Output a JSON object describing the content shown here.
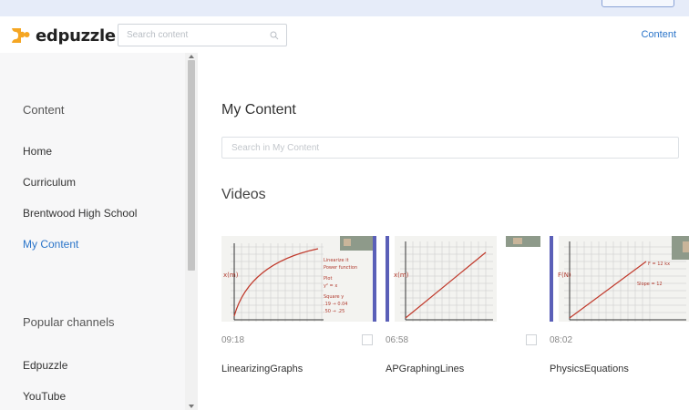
{
  "app": {
    "logo_text": "edpuzzle",
    "brand_color": "#f5a623"
  },
  "topbar": {
    "search_placeholder": "Search content",
    "right_link": "Content",
    "link_color": "#2a74c9"
  },
  "sidebar": {
    "heading_content": "Content",
    "items": [
      {
        "label": "Home"
      },
      {
        "label": "Curriculum"
      },
      {
        "label": "Brentwood High School"
      },
      {
        "label": "My Content",
        "active": true
      }
    ],
    "heading_channels": "Popular channels",
    "channels": [
      {
        "label": "Edpuzzle"
      },
      {
        "label": "YouTube"
      }
    ]
  },
  "main": {
    "title": "My Content",
    "search_placeholder": "Search in My Content",
    "section_title": "Videos",
    "videos": [
      {
        "title": "LinearizingGraphs",
        "duration": "09:18"
      },
      {
        "title": "APGraphingLines",
        "duration": "06:58"
      },
      {
        "title": "PhysicsEquations",
        "duration": "08:02"
      }
    ]
  }
}
